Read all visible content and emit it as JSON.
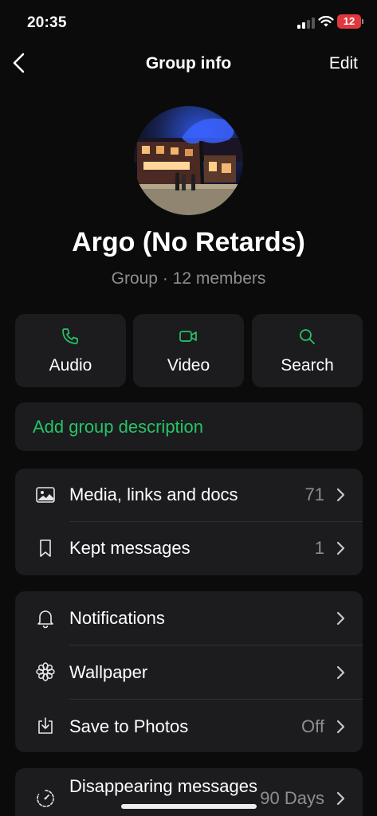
{
  "status": {
    "time": "20:35",
    "battery_level": "12",
    "battery_color": "#e0383e"
  },
  "nav": {
    "title": "Group info",
    "edit_label": "Edit",
    "back_icon": "chevron-left-icon"
  },
  "group": {
    "name": "Argo (No Retards)",
    "subtitle": "Group · 12 members"
  },
  "actions": [
    {
      "label": "Audio",
      "icon": "phone-icon"
    },
    {
      "label": "Video",
      "icon": "video-camera-icon"
    },
    {
      "label": "Search",
      "icon": "search-icon"
    }
  ],
  "description": {
    "placeholder": "Add group description",
    "color": "#25c467"
  },
  "media_section": [
    {
      "label": "Media, links and docs",
      "value": "71",
      "icon": "image-icon"
    },
    {
      "label": "Kept messages",
      "value": "1",
      "icon": "bookmark-icon"
    }
  ],
  "settings_section": [
    {
      "label": "Notifications",
      "value": "",
      "icon": "bell-icon"
    },
    {
      "label": "Wallpaper",
      "value": "",
      "icon": "wallpaper-flower-icon"
    },
    {
      "label": "Save to Photos",
      "value": "Off",
      "icon": "download-tray-icon"
    }
  ],
  "privacy_section": [
    {
      "label": "Disappearing messages",
      "value": "90 Days",
      "icon": "timer-icon"
    }
  ],
  "theme": {
    "accent": "#25c467",
    "card_bg": "#1c1c1e",
    "secondary_text": "#8e8e93"
  }
}
